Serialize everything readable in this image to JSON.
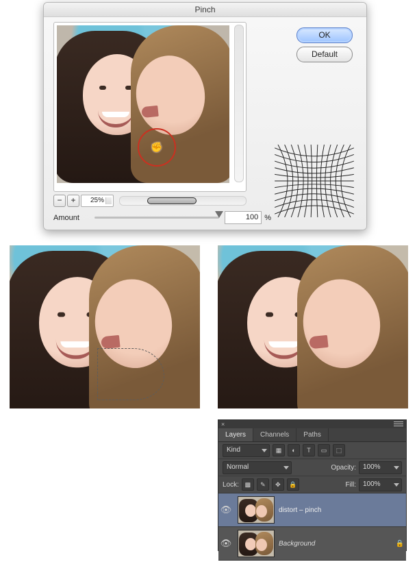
{
  "dialog": {
    "title": "Pinch",
    "ok_label": "OK",
    "default_label": "Default",
    "zoom_minus": "−",
    "zoom_plus": "+",
    "zoom_value": "25%",
    "amount_label": "Amount",
    "amount_value": "100",
    "amount_unit": "%",
    "cursor_icon_name": "hand-grab-cursor"
  },
  "panel": {
    "tabs": [
      "Layers",
      "Channels",
      "Paths"
    ],
    "active_tab": 0,
    "kind_label": "Kind",
    "kind_icons": [
      "image-filter-icon",
      "adjustment-filter-icon",
      "type-filter-icon",
      "shape-filter-icon",
      "smartobj-filter-icon"
    ],
    "blend_mode": "Normal",
    "opacity_label": "Opacity:",
    "opacity_value": "100%",
    "lock_label": "Lock:",
    "lock_icons": [
      "lock-transparent-icon",
      "lock-brush-icon",
      "lock-move-icon",
      "lock-all-icon"
    ],
    "fill_label": "Fill:",
    "fill_value": "100%",
    "layers": [
      {
        "name": "distort – pinch",
        "visible": true,
        "selected": true,
        "locked": false
      },
      {
        "name": "Background",
        "visible": true,
        "selected": false,
        "locked": true,
        "italic": true
      }
    ],
    "close_glyph": "×",
    "menu_icon_name": "panel-menu-icon",
    "eye_glyph": "👁",
    "lock_glyph": "🔒"
  },
  "kind_icon_glyphs": [
    "▦",
    "◐",
    "T",
    "▭",
    "⬚"
  ],
  "lock_icon_glyphs": [
    "▩",
    "✎",
    "✥",
    "🔒"
  ]
}
